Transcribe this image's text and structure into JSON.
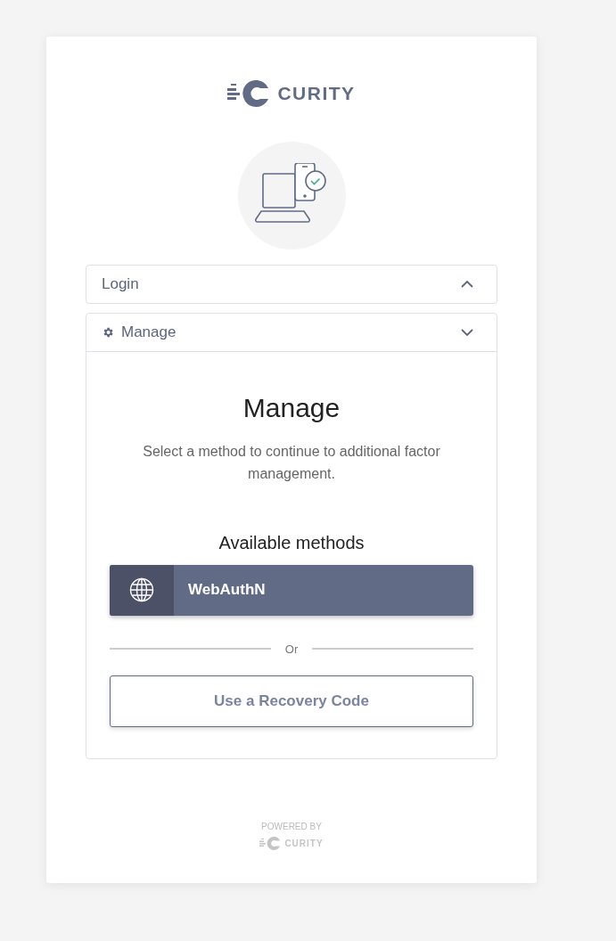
{
  "logo": {
    "text": "CURITY"
  },
  "sections": [
    {
      "label": "Login",
      "kind": "plain",
      "expanded": false
    },
    {
      "label": "Manage",
      "kind": "settings",
      "expanded": true
    }
  ],
  "manage": {
    "title": "Manage",
    "description": "Select a method to continue to additional factor management.",
    "methods_heading": "Available methods",
    "methods": [
      {
        "label": "WebAuthN"
      }
    ],
    "separator": "Or",
    "recovery_button": "Use a Recovery Code"
  },
  "footer": {
    "powered_by": "POWERED BY",
    "logo_text": "CURITY"
  }
}
